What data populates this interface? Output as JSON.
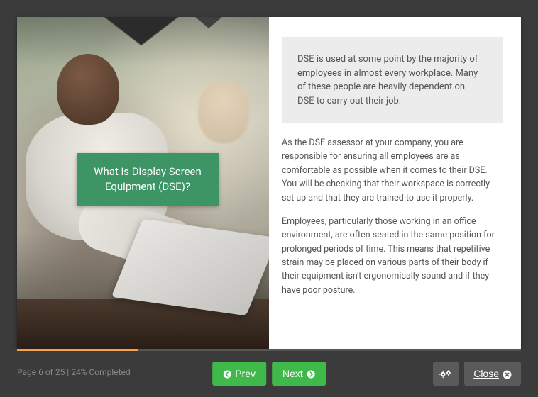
{
  "slide": {
    "title_box": "What is Display Screen Equipment (DSE)?",
    "highlight": "DSE is used at some point by the majority of employees in almost every workplace. Many of these people are heavily dependent on DSE to carry out their job.",
    "paragraph1": "As the DSE assessor at your company, you are responsible for ensuring all employees are as comfortable as possible when it comes to their DSE. You will be checking that their workspace is correctly set up and that they are trained to use it properly.",
    "paragraph2": "Employees, particularly those working in an office environment, are often seated in the same position for prolonged periods of time. This means that repetitive strain may be placed on various parts of their body if their equipment isn't ergonomically sound and if they have poor posture."
  },
  "nav": {
    "page_info": "Page 6 of 25 | 24% Completed",
    "prev_label": "Prev",
    "next_label": "Next",
    "close_label": "Close"
  },
  "progress": {
    "percent": 24
  },
  "colors": {
    "accent_green": "#3fb94a",
    "title_green": "#3d9464",
    "progress_orange": "#f5a04a"
  }
}
